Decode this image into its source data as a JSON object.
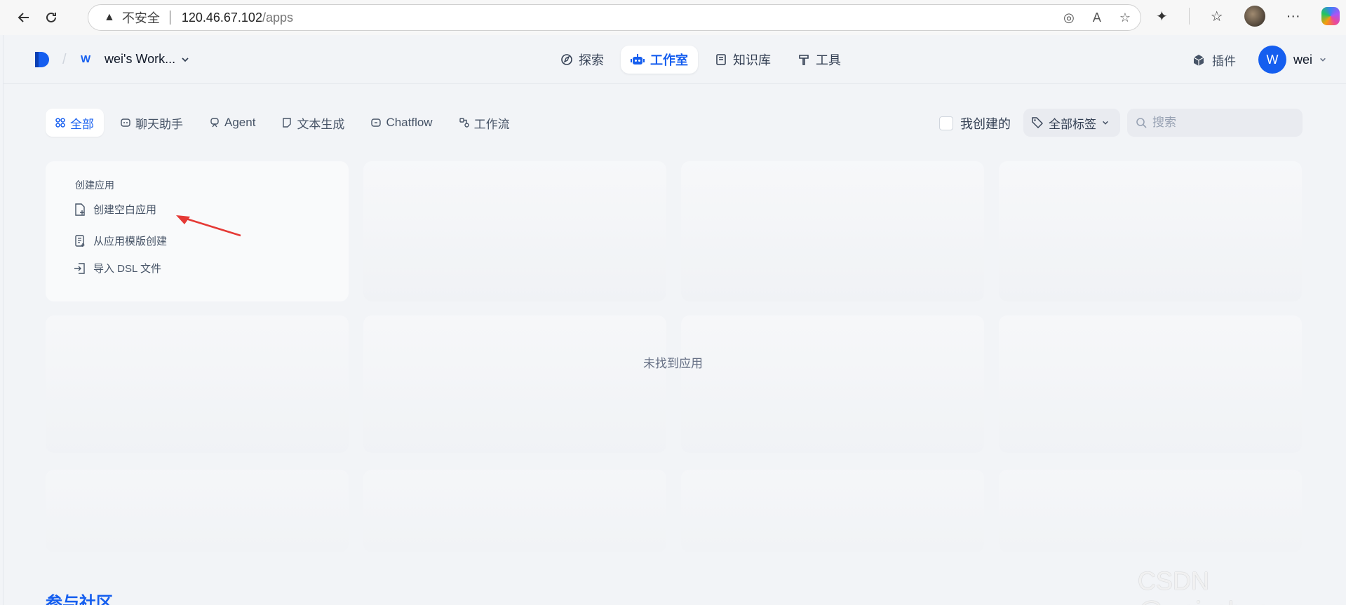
{
  "browser": {
    "security_label": "不安全",
    "url_host": "120.46.67.102",
    "url_path": "/apps"
  },
  "header": {
    "workspace_badge": "W",
    "workspace_name": "wei's Work...",
    "nav": [
      {
        "label": "探索",
        "icon": "compass-icon"
      },
      {
        "label": "工作室",
        "icon": "robot-icon",
        "active": true
      },
      {
        "label": "知识库",
        "icon": "book-icon"
      },
      {
        "label": "工具",
        "icon": "hammer-icon"
      }
    ],
    "plugin_label": "插件",
    "user_initial": "W",
    "user_name": "wei"
  },
  "filters": {
    "tabs": [
      {
        "label": "全部",
        "icon": "grid-icon",
        "active": true
      },
      {
        "label": "聊天助手",
        "icon": "chat-icon"
      },
      {
        "label": "Agent",
        "icon": "agent-icon"
      },
      {
        "label": "文本生成",
        "icon": "document-icon"
      },
      {
        "label": "Chatflow",
        "icon": "chatflow-icon"
      },
      {
        "label": "工作流",
        "icon": "workflow-icon"
      }
    ],
    "mine_label": "我创建的",
    "tag_select": "全部标签",
    "search_placeholder": "搜索"
  },
  "create_card": {
    "title": "创建应用",
    "items": [
      {
        "label": "创建空白应用",
        "icon": "new-file-icon"
      },
      {
        "label": "从应用模版创建",
        "icon": "template-icon"
      },
      {
        "label": "导入 DSL 文件",
        "icon": "import-icon"
      }
    ]
  },
  "empty_message": "未找到应用",
  "community_heading": "参与社区",
  "watermark": "CSDN @wei_shuo",
  "colors": {
    "accent": "#155eef",
    "background": "#f2f4f7",
    "arrow": "#e53935"
  }
}
